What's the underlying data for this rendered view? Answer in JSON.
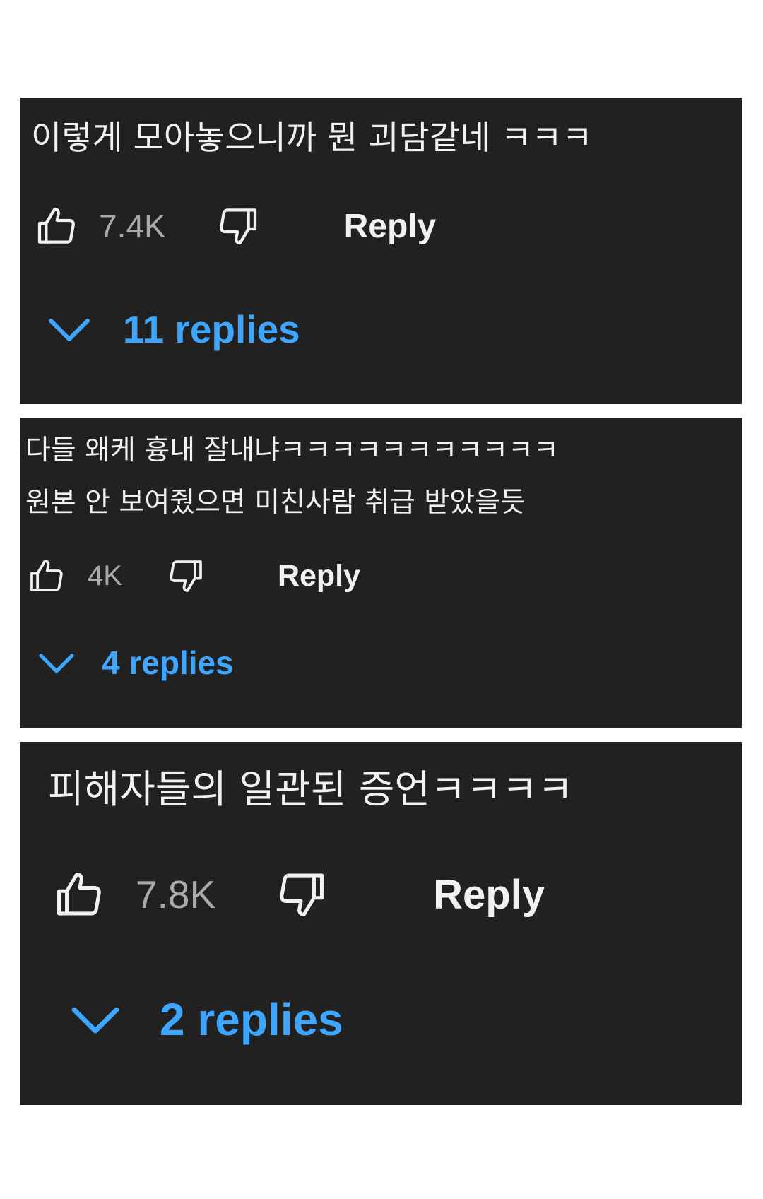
{
  "comments": [
    {
      "text_lines": [
        "이렇게 모아놓으니까 뭔 괴담같네 ㅋㅋㅋ"
      ],
      "like_count": "7.4K",
      "reply_label": "Reply",
      "replies_label": "11 replies"
    },
    {
      "text_lines": [
        "다들 왜케 흉내 잘내냐ㅋㅋㅋㅋㅋㅋㅋㅋㅋㅋㅋ",
        "원본 안 보여줬으면 미친사람 취급 받았을듯"
      ],
      "like_count": "4K",
      "reply_label": "Reply",
      "replies_label": "4 replies"
    },
    {
      "text_lines": [
        "피해자들의 일관된 증언ㅋㅋㅋㅋ"
      ],
      "like_count": "7.8K",
      "reply_label": "Reply",
      "replies_label": "2 replies"
    }
  ],
  "icons": {
    "like": "thumbs-up-outline",
    "dislike": "thumbs-down-outline",
    "expand": "chevron-down"
  },
  "colors": {
    "card_background": "#212121",
    "text": "#f1f1f1",
    "count_text": "#aaaaaa",
    "link_blue": "#3ea6ff",
    "page_background": "#ffffff"
  }
}
